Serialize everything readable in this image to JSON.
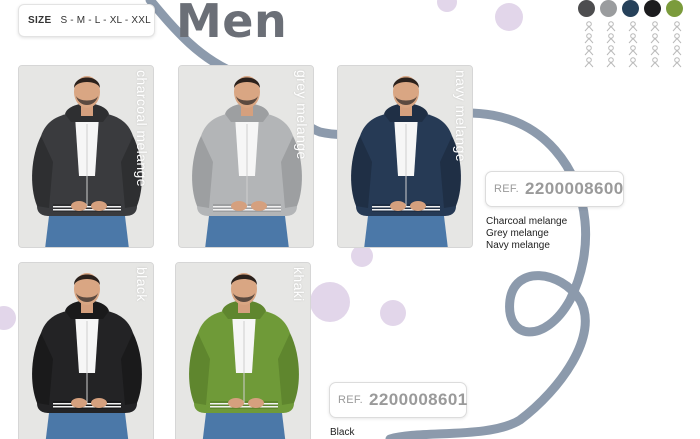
{
  "size_box": {
    "label": "SIZE",
    "values": "S - M - L - XL - XXL"
  },
  "title": "Men",
  "swatches": [
    {
      "name": "charcoal melange",
      "color": "#4d4d4f"
    },
    {
      "name": "grey melange",
      "color": "#9a9c9e"
    },
    {
      "name": "navy melange",
      "color": "#26415a"
    },
    {
      "name": "black",
      "color": "#1c1c1e"
    },
    {
      "name": "khaki",
      "color": "#7b9b3c"
    }
  ],
  "care_icons": [
    "wash-icon",
    "bleach-icon",
    "dry-icon",
    "iron-icon",
    "dryclean-icon"
  ],
  "products": [
    {
      "label": "charcoal melange",
      "jacket": "#3a3b3e",
      "trim": "#2e2f31"
    },
    {
      "label": "grey melange",
      "jacket": "#b3b5b7",
      "trim": "#9d9fa1"
    },
    {
      "label": "navy melange",
      "jacket": "#263a55",
      "trim": "#1f2f45"
    },
    {
      "label": "black",
      "jacket": "#232325",
      "trim": "#1a1a1b"
    },
    {
      "label": "khaki",
      "jacket": "#6f9a38",
      "trim": "#5f862e"
    }
  ],
  "references": [
    {
      "prefix": "REF.",
      "code": "2200008600",
      "colors": [
        "Charcoal melange",
        "Grey melange",
        "Navy melange"
      ]
    },
    {
      "prefix": "REF.",
      "code": "2200008601",
      "colors": [
        "Black"
      ]
    }
  ],
  "accent": {
    "line": "#8c9aac",
    "blob": "#ddd0e6"
  }
}
